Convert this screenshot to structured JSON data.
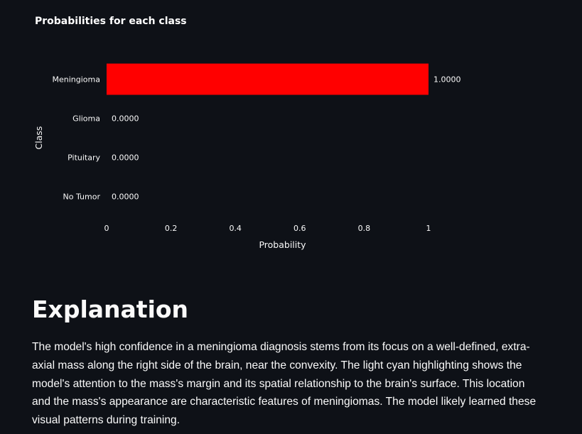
{
  "chart_data": {
    "type": "bar",
    "orientation": "horizontal",
    "title": "Probabilities for each class",
    "xlabel": "Probability",
    "ylabel": "Class",
    "categories": [
      "Meningioma",
      "Glioma",
      "Pituitary",
      "No Tumor"
    ],
    "values": [
      1.0,
      0.0,
      0.0,
      0.0
    ],
    "value_labels": [
      "1.0000",
      "0.0000",
      "0.0000",
      "0.0000"
    ],
    "xlim": [
      0,
      1
    ],
    "xticks": [
      0,
      0.2,
      0.4,
      0.6,
      0.8,
      1
    ],
    "xtick_labels": [
      "0",
      "0.2",
      "0.4",
      "0.6",
      "0.8",
      "1"
    ],
    "bar_color": "#ff0000",
    "grid": false
  },
  "explanation": {
    "heading": "Explanation",
    "body": "The model's high confidence in a meningioma diagnosis stems from its focus on a well-defined, extra-axial mass along the right side of the brain, near the convexity. The light cyan highlighting shows the model's attention to the mass's margin and its spatial relationship to the brain's surface. This location and the mass's appearance are characteristic features of meningiomas. The model likely learned these visual patterns during training."
  },
  "colors": {
    "background": "#0e1117",
    "text": "#fafafa"
  }
}
